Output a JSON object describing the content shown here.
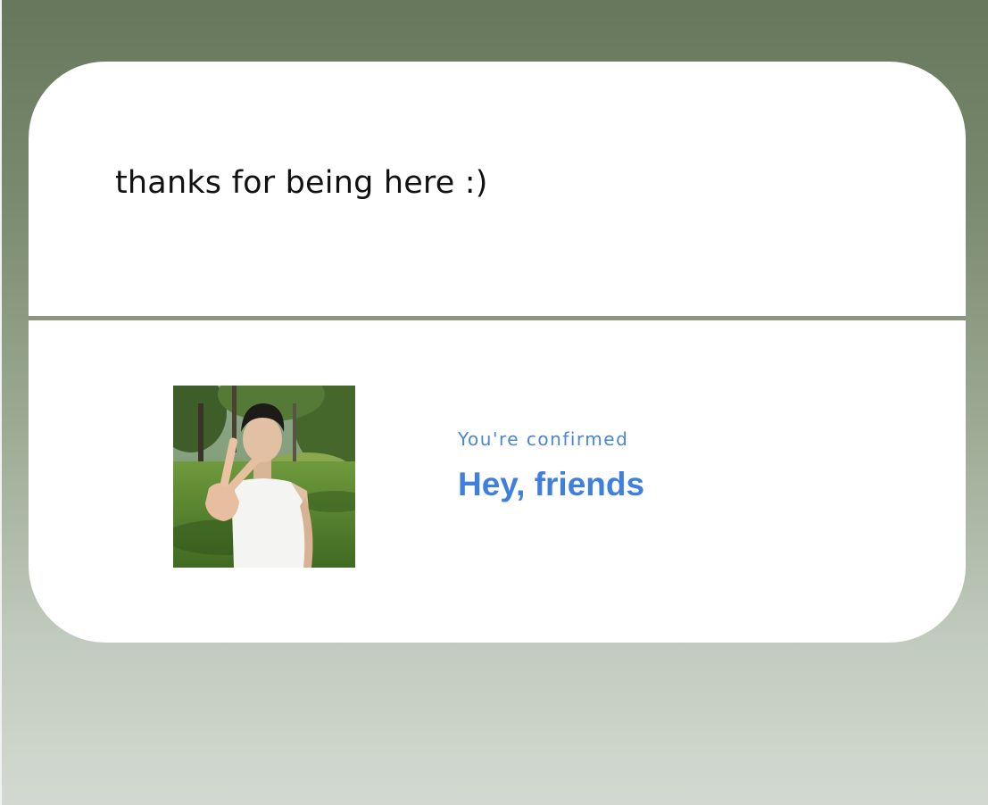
{
  "message": {
    "text": "thanks for being here :)"
  },
  "confirmation": {
    "subtitle": "You're confirmed",
    "title": "Hey, friends",
    "image_alt": "photo of a person in a park making a peace sign"
  },
  "colors": {
    "accent": "#3f7fdd",
    "subtitle": "#4a86d8",
    "card": "#ffffff",
    "background_top": "#66775b",
    "background_bottom": "#d3d9d0"
  }
}
